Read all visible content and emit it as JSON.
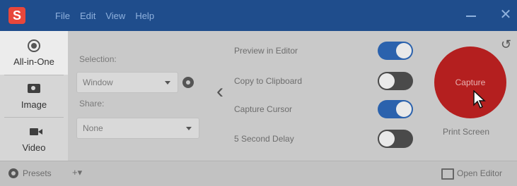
{
  "titlebar": {
    "logo": "S",
    "menu": [
      "File",
      "Edit",
      "View",
      "Help"
    ],
    "minimize_glyph": "—",
    "close_glyph": "✕"
  },
  "modes": [
    {
      "label": "All-in-One",
      "icon": "radio-icon",
      "active": true
    },
    {
      "label": "Image",
      "icon": "camera-icon",
      "active": false
    },
    {
      "label": "Video",
      "icon": "video-icon",
      "active": false
    }
  ],
  "settings": {
    "selection_label": "Selection:",
    "selection_value": "Window",
    "share_label": "Share:",
    "share_value": "None"
  },
  "options": [
    {
      "label": "Preview in Editor",
      "on": true
    },
    {
      "label": "Copy to Clipboard",
      "on": false
    },
    {
      "label": "Capture Cursor",
      "on": true
    },
    {
      "label": "5 Second Delay",
      "on": false
    }
  ],
  "capture": {
    "label": "Capture",
    "shortcut": "Print Screen"
  },
  "bottombar": {
    "presets_label": "Presets",
    "presets_add": "+▾",
    "open_editor": "Open Editor"
  },
  "colors": {
    "titlebar": "#1f4d8c",
    "toggle_on": "#2b62ad",
    "toggle_off": "#4a4a4a",
    "capture_button": "#b41f1f"
  }
}
